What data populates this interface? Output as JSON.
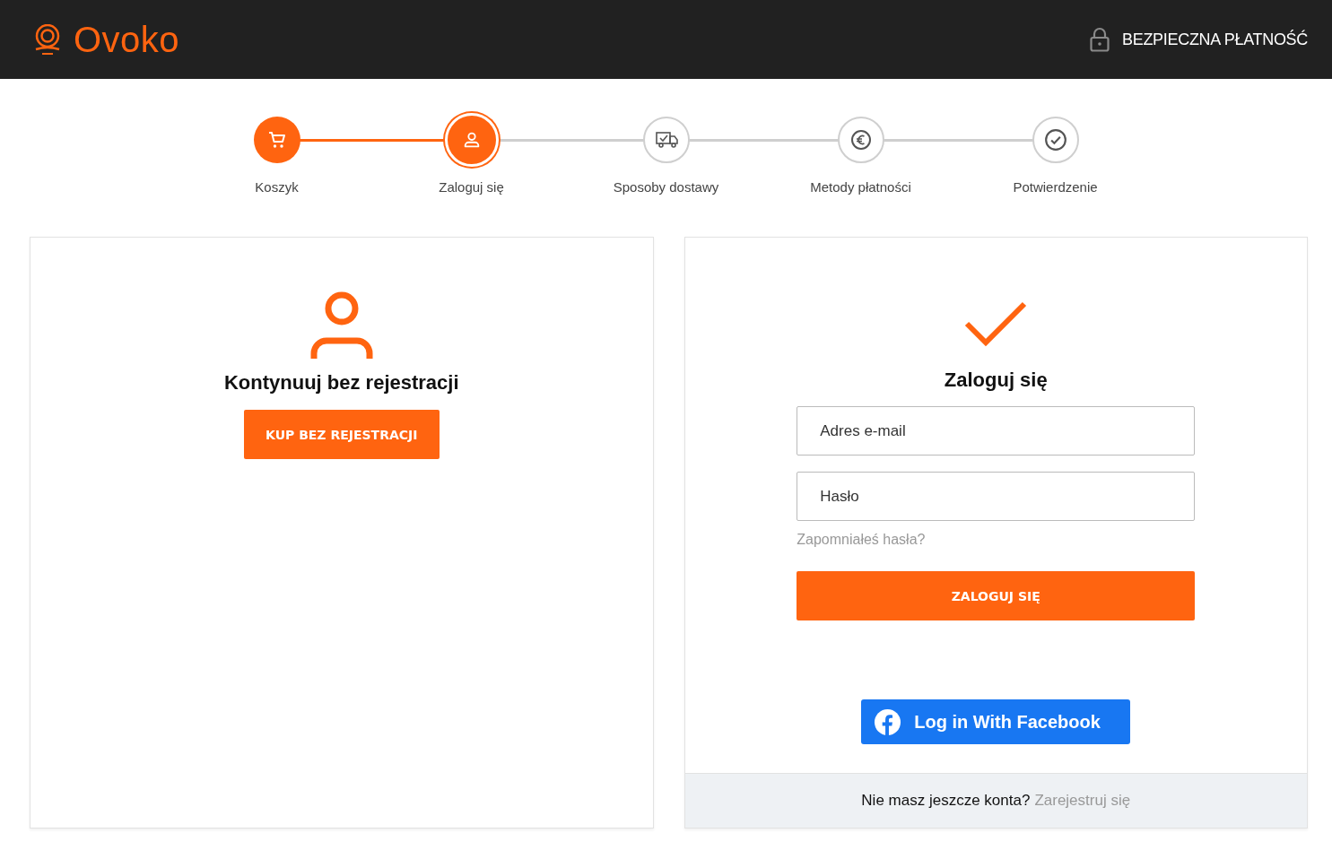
{
  "header": {
    "logo": "Ovoko",
    "secure_label": "BEZPIECZNA PŁATNOŚĆ"
  },
  "steps": [
    {
      "label": "Koszyk",
      "completed": true,
      "selected": false
    },
    {
      "label": "Zaloguj się",
      "completed": false,
      "selected": true
    },
    {
      "label": "Sposoby dostawy",
      "completed": false,
      "selected": false
    },
    {
      "label": "Metody płatności",
      "completed": false,
      "selected": false
    },
    {
      "label": "Potwierdzenie",
      "completed": false,
      "selected": false
    }
  ],
  "guest": {
    "title": "Kontynuuj bez rejestracji",
    "button": "KUP BEZ REJESTRACJI"
  },
  "login": {
    "title": "Zaloguj się",
    "email": {
      "placeholder": "Adres e-mail"
    },
    "password": {
      "placeholder": "Hasło"
    },
    "forgot": "Zapomniałeś hasła?",
    "button": "ZALOGUJ SIĘ",
    "facebook": "Log in With Facebook",
    "footer_text": "Nie masz jeszcze konta?",
    "footer_link": "Zarejestruj się"
  }
}
